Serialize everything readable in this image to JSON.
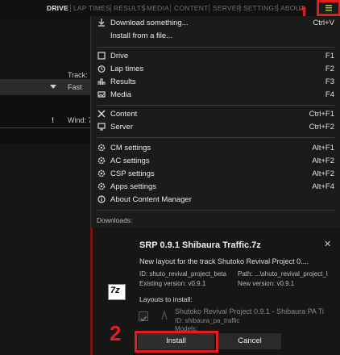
{
  "topnav": {
    "items": [
      "DRIVE",
      "LAP TIMES",
      "RESULTS",
      "MEDIA",
      "CONTENT",
      "SERVER",
      "SETTINGS",
      "ABOUT"
    ],
    "active": "DRIVE",
    "menu_icon": "hamburger-menu-icon"
  },
  "left": {
    "track_label": "Track:",
    "track_value": "Fast",
    "wind_label": "Wind: 7.",
    "exclamation": "!"
  },
  "menu": {
    "items": [
      {
        "label": "Download something...",
        "shortcut": "Ctrl+V",
        "icon": "download-icon"
      },
      {
        "label": "Install from a file...",
        "shortcut": "",
        "icon": ""
      },
      {
        "label": "Drive",
        "shortcut": "F1",
        "icon": "drive-icon"
      },
      {
        "label": "Lap times",
        "shortcut": "F2",
        "icon": "stopwatch-icon"
      },
      {
        "label": "Results",
        "shortcut": "F3",
        "icon": "results-icon"
      },
      {
        "label": "Media",
        "shortcut": "F4",
        "icon": "media-icon"
      },
      {
        "label": "Content",
        "shortcut": "Ctrl+F1",
        "icon": "content-icon"
      },
      {
        "label": "Server",
        "shortcut": "Ctrl+F2",
        "icon": "server-icon"
      },
      {
        "label": "CM settings",
        "shortcut": "Alt+F1",
        "icon": "gear-icon"
      },
      {
        "label": "AC settings",
        "shortcut": "Alt+F2",
        "icon": "gear-icon"
      },
      {
        "label": "CSP settings",
        "shortcut": "Alt+F2",
        "icon": "gear-icon"
      },
      {
        "label": "Apps settings",
        "shortcut": "Alt+F4",
        "icon": "gear-icon"
      },
      {
        "label": "About Content Manager",
        "shortcut": "",
        "icon": "info-icon"
      }
    ]
  },
  "downloads": {
    "label": "Downloads:",
    "title": "SRP 0.9.1 Shibaura Traffic.7z",
    "description": "New layout for the track Shutoko Revival Project 0....",
    "id_text": "ID: shuto_revival_project_beta",
    "path_text": "Path: ...\\shuto_revival_project_l",
    "existing_version": "Existing version: v0.9.1",
    "new_version": "New version: v0.9.1",
    "archive_icon_text": "7z",
    "layouts_label": "Layouts to install:",
    "layout_name": "Shutoko Revival Project 0.9.1 - Shibaura PA Ti",
    "layout_id": "ID: shibaura_pa_traffic",
    "layout_models": "Models:",
    "install_label": "Install",
    "cancel_label": "Cancel"
  },
  "annotations": {
    "marker1": "1",
    "marker2": "2",
    "accent_color": "#e11d1d"
  }
}
